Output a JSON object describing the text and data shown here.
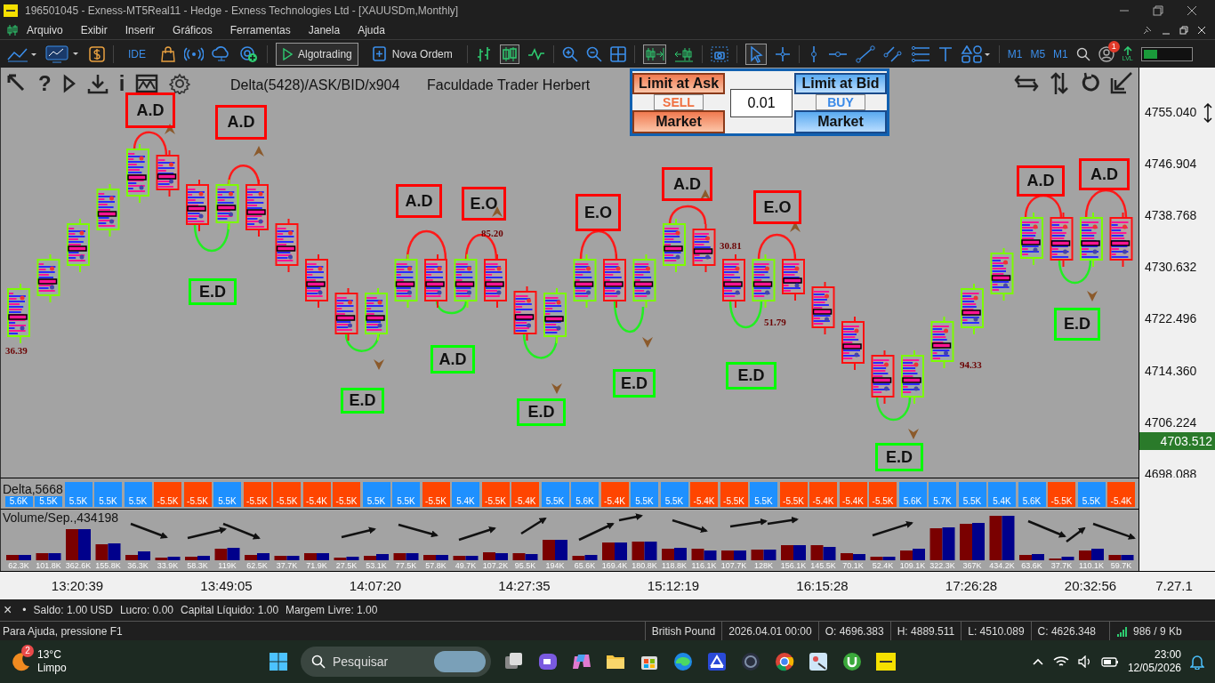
{
  "window": {
    "title": "196501045 - Exness-MT5Real11 - Hedge - Exness Technologies Ltd - [XAUUSDm,Monthly]"
  },
  "menu": [
    "Arquivo",
    "Exibir",
    "Inserir",
    "Gráficos",
    "Ferramentas",
    "Janela",
    "Ajuda"
  ],
  "toolbar": {
    "ide": "IDE",
    "algotrading": {
      "label": "Algotrading",
      "selected": true
    },
    "new_order": "Nova Ordem",
    "timeframes": [
      "M1",
      "M5",
      "M1"
    ],
    "notification_count": "1",
    "level_label": "LVL",
    "meter": {
      "level": 0.3
    }
  },
  "chart": {
    "indicator": "Delta(5428)/ASK/BID/x904",
    "author": "Faculdade Trader Herbert",
    "help_glyph": "?",
    "info_glyph": "i",
    "trade_panel": {
      "sell_limit": "Limit at Ask",
      "sell_tag": "SELL",
      "sell_market": "Market",
      "volume": "0.01",
      "buy_limit": "Limit at Bid",
      "buy_tag": "BUY",
      "buy_market": "Market"
    },
    "price_axis": [
      "4755.040",
      "4746.904",
      "4738.768",
      "4730.632",
      "4722.496",
      "4714.360",
      "4706.224",
      "4698.088"
    ],
    "current_price": "4703.512",
    "annotations": [
      {
        "text": "A.D",
        "color": "#ff0000"
      },
      {
        "text": "A.D",
        "color": "#ff0000"
      },
      {
        "text": "A.D",
        "color": "#ff0000"
      },
      {
        "text": "E.O",
        "color": "#ff0000"
      },
      {
        "text": "E.O",
        "color": "#ff0000"
      },
      {
        "text": "A.D",
        "color": "#ff0000"
      },
      {
        "text": "E.O",
        "color": "#ff0000"
      },
      {
        "text": "A.D",
        "color": "#ff0000"
      },
      {
        "text": "A.D",
        "color": "#ff0000"
      },
      {
        "text": "E.D",
        "color": "#00ff00"
      },
      {
        "text": "E.D",
        "color": "#00ff00"
      },
      {
        "text": "A.D",
        "color": "#00ff00"
      },
      {
        "text": "E.D",
        "color": "#00ff00"
      },
      {
        "text": "E.D",
        "color": "#00ff00"
      },
      {
        "text": "E.D",
        "color": "#00ff00"
      },
      {
        "text": "E.D",
        "color": "#00ff00"
      },
      {
        "text": "E.D",
        "color": "#00ff00"
      }
    ],
    "value_labels": [
      "36.39",
      "85.20",
      "30.81",
      "51.79",
      "94.33"
    ]
  },
  "delta_panel": {
    "label": "Delta,5668",
    "cells": [
      {
        "text": "5.6K",
        "color": "#1e90ff"
      },
      {
        "text": "5.5K",
        "color": "#1e90ff"
      },
      {
        "text": "5.5K",
        "color": "#1e90ff"
      },
      {
        "text": "5.5K",
        "color": "#1e90ff"
      },
      {
        "text": "5.5K",
        "color": "#1e90ff"
      },
      {
        "text": "-5.5K",
        "color": "#ff4500"
      },
      {
        "text": "-5.5K",
        "color": "#ff4500"
      },
      {
        "text": "5.5K",
        "color": "#1e90ff"
      },
      {
        "text": "-5.5K",
        "color": "#ff4500"
      },
      {
        "text": "-5.5K",
        "color": "#ff4500"
      },
      {
        "text": "-5.4K",
        "color": "#ff4500"
      },
      {
        "text": "-5.5K",
        "color": "#ff4500"
      },
      {
        "text": "5.5K",
        "color": "#1e90ff"
      },
      {
        "text": "5.5K",
        "color": "#1e90ff"
      },
      {
        "text": "-5.5K",
        "color": "#ff4500"
      },
      {
        "text": "5.4K",
        "color": "#1e90ff"
      },
      {
        "text": "-5.5K",
        "color": "#ff4500"
      },
      {
        "text": "-5.4K",
        "color": "#ff4500"
      },
      {
        "text": "5.5K",
        "color": "#1e90ff"
      },
      {
        "text": "5.6K",
        "color": "#1e90ff"
      },
      {
        "text": "-5.4K",
        "color": "#ff4500"
      },
      {
        "text": "5.5K",
        "color": "#1e90ff"
      },
      {
        "text": "5.5K",
        "color": "#1e90ff"
      },
      {
        "text": "-5.4K",
        "color": "#ff4500"
      },
      {
        "text": "-5.5K",
        "color": "#ff4500"
      },
      {
        "text": "5.5K",
        "color": "#1e90ff"
      },
      {
        "text": "-5.5K",
        "color": "#ff4500"
      },
      {
        "text": "-5.4K",
        "color": "#ff4500"
      },
      {
        "text": "-5.4K",
        "color": "#ff4500"
      },
      {
        "text": "-5.5K",
        "color": "#ff4500"
      },
      {
        "text": "5.6K",
        "color": "#1e90ff"
      },
      {
        "text": "5.7K",
        "color": "#1e90ff"
      },
      {
        "text": "5.5K",
        "color": "#1e90ff"
      },
      {
        "text": "5.4K",
        "color": "#1e90ff"
      },
      {
        "text": "5.6K",
        "color": "#1e90ff"
      },
      {
        "text": "-5.5K",
        "color": "#ff4500"
      },
      {
        "text": "5.5K",
        "color": "#1e90ff"
      },
      {
        "text": "-5.4K",
        "color": "#ff4500"
      }
    ]
  },
  "volume_panel": {
    "label": "Volume/Sep.,434198",
    "labels": [
      "62.3K",
      "101.8K",
      "362.6K",
      "155.8K",
      "36.3K",
      "33.9K",
      "58.3K",
      "119K",
      "62.5K",
      "37.7K",
      "71.9K",
      "27.5K",
      "53.1K",
      "77.5K",
      "57.8K",
      "49.7K",
      "107.2K",
      "95.5K",
      "194K",
      "65.6K",
      "169.4K",
      "180.8K",
      "118.8K",
      "116.1K",
      "107.7K",
      "128K",
      "156.1K",
      "145.5K",
      "70.1K",
      "52.4K",
      "109.1K",
      "322.3K",
      "367K",
      "434.2K",
      "63.6K",
      "37.7K",
      "110.1K",
      "59.7K"
    ]
  },
  "time_axis": {
    "labels": [
      "13:20:39",
      "13:49:05",
      "14:07:20",
      "14:27:35",
      "15:12:19",
      "16:15:28",
      "17:26:28",
      "20:32:56"
    ],
    "version": "7.27.1"
  },
  "account_bar": {
    "close_glyph": "×",
    "bullet": "•",
    "items": [
      "Saldo: 1.00 USD",
      "Lucro: 0.00",
      "Capital Líquido: 1.00",
      "Margem Livre: 1.00"
    ]
  },
  "status_bar": {
    "help": "Para Ajuda, pressione F1",
    "items": [
      "British Pound",
      "2026.04.01 00:00",
      "O: 4696.383",
      "H: 4889.511",
      "L: 4510.089",
      "C: 4626.348"
    ],
    "traffic": "986 / 9 Kb"
  },
  "taskbar": {
    "weather_badge": "2",
    "temperature": "13°C",
    "condition": "Limpo",
    "search": {
      "placeholder": "Pesquisar"
    },
    "time": "23:00",
    "date": "12/05/2026"
  }
}
